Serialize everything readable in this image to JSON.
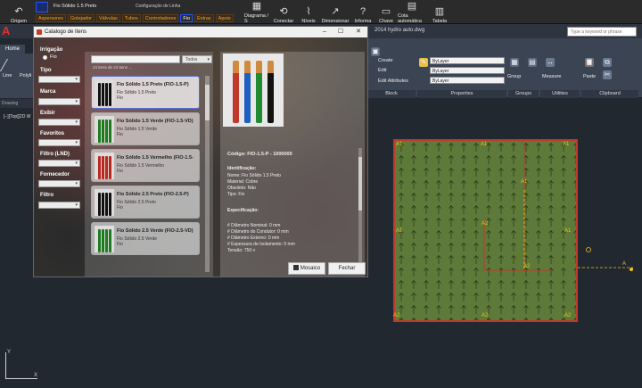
{
  "topbar": {
    "buttons": [
      {
        "label": "Origem",
        "icon": "undo-icon"
      },
      {
        "label": "Diagrama / S",
        "icon": "diagram-icon"
      },
      {
        "label": "Conectar",
        "icon": "connect-icon"
      },
      {
        "label": "Níveis",
        "icon": "levels-icon"
      },
      {
        "label": "Dimensionar",
        "icon": "dimension-icon"
      },
      {
        "label": "Informa",
        "icon": "question-icon"
      },
      {
        "label": "Chave",
        "icon": "comment-icon"
      },
      {
        "label": "Cota automática",
        "icon": "auto-dim-icon"
      },
      {
        "label": "Tabela",
        "icon": "table-icon"
      }
    ],
    "combo_value": "Fio Sólido 1.5 Preto",
    "line_config": "Configuração de Linha",
    "menu_tabs": [
      "Aspersores",
      "Gotejador",
      "Válvulas",
      "Tubos",
      "Controladores",
      "Fio",
      "Extras",
      "Apoio"
    ],
    "active_tab": "Fio"
  },
  "title": {
    "document": "2014 hydro auto.dwg",
    "search_placeholder": "Type a keyword or phrase"
  },
  "acad_left": {
    "home_tab": "Home",
    "tool_line": "Line",
    "tool_polyline": "Polyli",
    "drawing_tab": "Drawing",
    "view_label": "[−][Top][2D W"
  },
  "ribbon": {
    "layer_items": [
      "Create",
      "Edit",
      "Edit Attributes"
    ],
    "bylayer_1": "ByLayer",
    "bylayer_2": "ByLayer",
    "bylayer_3": "ByLayer",
    "group_label": "Group",
    "measure_label": "Measure",
    "paste_label": "Paste",
    "panels": [
      "Block",
      "Properties",
      "Groups",
      "Utilities",
      "Clipboard"
    ]
  },
  "dialog": {
    "title": "Catalogo de Itens",
    "filters": {
      "irrigacao_label": "Irrigação",
      "irrigacao_option": "Fio",
      "tipo": "Tipo",
      "marca": "Marca",
      "exibir": "Exibir",
      "favoritos": "Favoritos",
      "filtro_lnd": "Filtro (LND)",
      "fornecedor": "Fornecedor",
      "filtro": "Filtro"
    },
    "search_value": "",
    "view_select": "Todos",
    "count_text": "24 itens de 24 itens ...",
    "items": [
      {
        "title": "Fio Sólido 1.5 Preto (FIO-1.5-P)",
        "line2": "Fio Sólido 1.5 Preto",
        "line3": "Fio",
        "colors": [
          "#111111",
          "#111111",
          "#111111",
          "#111111"
        ]
      },
      {
        "title": "Fio Sólido 1.5 Verde (FIO-1.5-VD)",
        "line2": "Fio Sólido 1.5 Verde",
        "line3": "Fio",
        "colors": [
          "#1f7a1f",
          "#1f7a1f",
          "#1f7a1f",
          "#1f7a1f"
        ]
      },
      {
        "title": "Fio Sólido 1.5 Vermelho (FIO-1.5-",
        "line2": "Fio Sólido 1.5 Vermelho",
        "line3": "Fio",
        "colors": [
          "#b8281f",
          "#b8281f",
          "#b8281f",
          "#b8281f"
        ]
      },
      {
        "title": "Fio Sólido 2.5 Preto (FIO-2.5-P)",
        "line2": "Fio Sólido 2.5 Preto",
        "line3": "Fio",
        "colors": [
          "#111111",
          "#111111",
          "#111111",
          "#111111"
        ]
      },
      {
        "title": "Fio Sólido 2.5 Verde (FIO-2.5-VD)",
        "line2": "Fio Sólido 2.5 Verde",
        "line3": "Fio",
        "colors": [
          "#1f7a1f",
          "#1f7a1f",
          "#1f7a1f",
          "#1f7a1f"
        ]
      }
    ],
    "detail": {
      "code": "Código: FIO-1.5-P - 1000000",
      "ident_header": "Identificação:",
      "nome": "Nome: Fio Sólido 1.5 Preto",
      "material": "Material: Cobre",
      "obsoleto": "Obsoleto: Não",
      "tipo": "Tipo: Fio",
      "spec_header": "Especificação:",
      "spec_lines": [
        "# Diâmetro Nominal: 0 mm",
        "# Diâmetro do Condutor: 0 mm",
        "# Diâmetro Externo: 0 mm",
        "# Espessura de Isolamento: 0 mm",
        "Tensão: 750 v"
      ],
      "image_colors": [
        "#c0392b",
        "#1e5fbf",
        "#1f8a2f",
        "#111111"
      ]
    },
    "btn_mosaico": "Mosaico",
    "btn_fechar": "Fechar"
  },
  "drawing_labels": {
    "a1": "A1",
    "a2": "A2",
    "a": "A"
  },
  "colors": {
    "drawing_fill": "#5e7a3a",
    "drawing_border": "#c0392b",
    "label_yellow": "#f1c40f",
    "active_tab_border": "#2255ff"
  }
}
